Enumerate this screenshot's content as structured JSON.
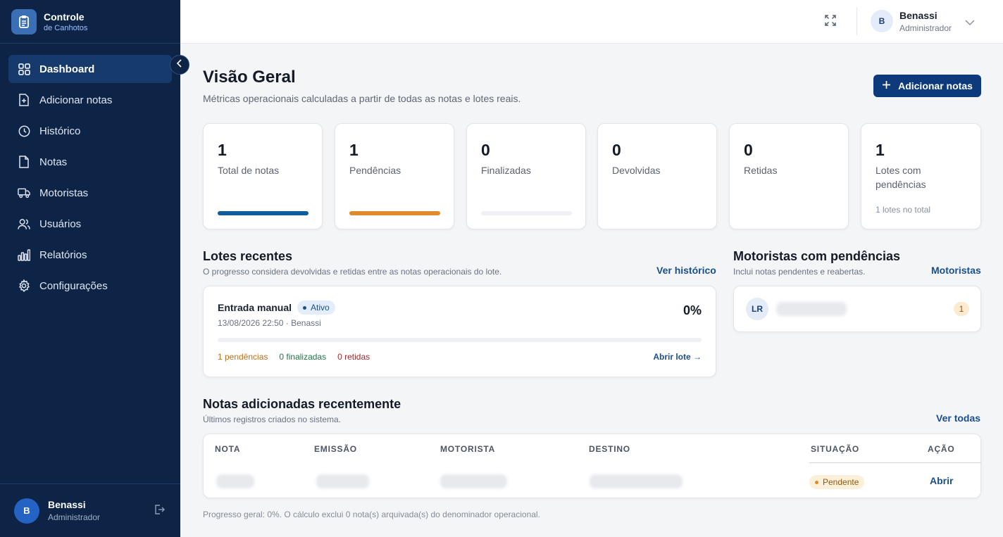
{
  "brand": {
    "title": "Controle",
    "subtitle": "de Canhotos",
    "icon": "clipboard-icon"
  },
  "sidebar": {
    "items": [
      {
        "label": "Dashboard",
        "icon": "grid-icon",
        "active": true
      },
      {
        "label": "Adicionar notas",
        "icon": "file-plus-icon"
      },
      {
        "label": "Histórico",
        "icon": "clock-icon"
      },
      {
        "label": "Notas",
        "icon": "file-icon"
      },
      {
        "label": "Motoristas",
        "icon": "truck-icon"
      },
      {
        "label": "Usuários",
        "icon": "users-icon"
      },
      {
        "label": "Relatórios",
        "icon": "bar-chart-icon"
      },
      {
        "label": "Configurações",
        "icon": "gear-icon"
      }
    ],
    "user": {
      "initial": "B",
      "name": "Benassi",
      "role": "Administrador"
    }
  },
  "topbar": {
    "user": {
      "initial": "B",
      "name": "Benassi",
      "role": "Administrador"
    }
  },
  "header": {
    "title": "Visão Geral",
    "subtitle": "Métricas operacionais calculadas a partir de todas as notas e lotes reais.",
    "add_button": "Adicionar notas"
  },
  "stats": [
    {
      "value": "1",
      "label": "Total de notas",
      "progress": 1.0,
      "color": "#0f5e9c"
    },
    {
      "value": "1",
      "label": "Pendências",
      "progress": 1.0,
      "color": "#e08a2e"
    },
    {
      "value": "0",
      "label": "Finalizadas",
      "progress": 0,
      "color": "#2e8b57"
    },
    {
      "value": "0",
      "label": "Devolvidas"
    },
    {
      "value": "0",
      "label": "Retidas"
    },
    {
      "value": "1",
      "label": "Lotes com pendências",
      "footer": "1 lotes no total"
    }
  ],
  "lotes": {
    "title": "Lotes recentes",
    "subtitle": "O progresso considera devolvidas e retidas entre as notas operacionais do lote.",
    "link": "Ver histórico",
    "item": {
      "name": "Entrada manual",
      "status": "Ativo",
      "meta": "13/08/2026 22:50 · Benassi",
      "percent": "0%",
      "progress": 0,
      "pendencias": "1 pendências",
      "finalizadas": "0 finalizadas",
      "retidas": "0 retidas",
      "open": "Abrir lote →"
    }
  },
  "motoristas": {
    "title": "Motoristas com pendências",
    "subtitle": "Inclui notas pendentes e reabertas.",
    "link": "Motoristas",
    "item": {
      "initials": "LR",
      "count": "1"
    }
  },
  "notas": {
    "title": "Notas adicionadas recentemente",
    "subtitle": "Últimos registros criados no sistema.",
    "link": "Ver todas",
    "columns": [
      "NOTA",
      "EMISSÃO",
      "MOTORISTA",
      "DESTINO",
      "SITUAÇÃO",
      "AÇÃO"
    ],
    "row": {
      "status": "Pendente",
      "action": "Abrir"
    }
  },
  "footer": "Progresso geral: 0%. O cálculo exclui 0 nota(s) arquivada(s) do denominador operacional.",
  "colors": {
    "sidebar": "#0d2447",
    "accent": "#0c3a7a",
    "pending": "#c2701a",
    "finalized": "#1f7a45",
    "retained": "#a3282b"
  }
}
